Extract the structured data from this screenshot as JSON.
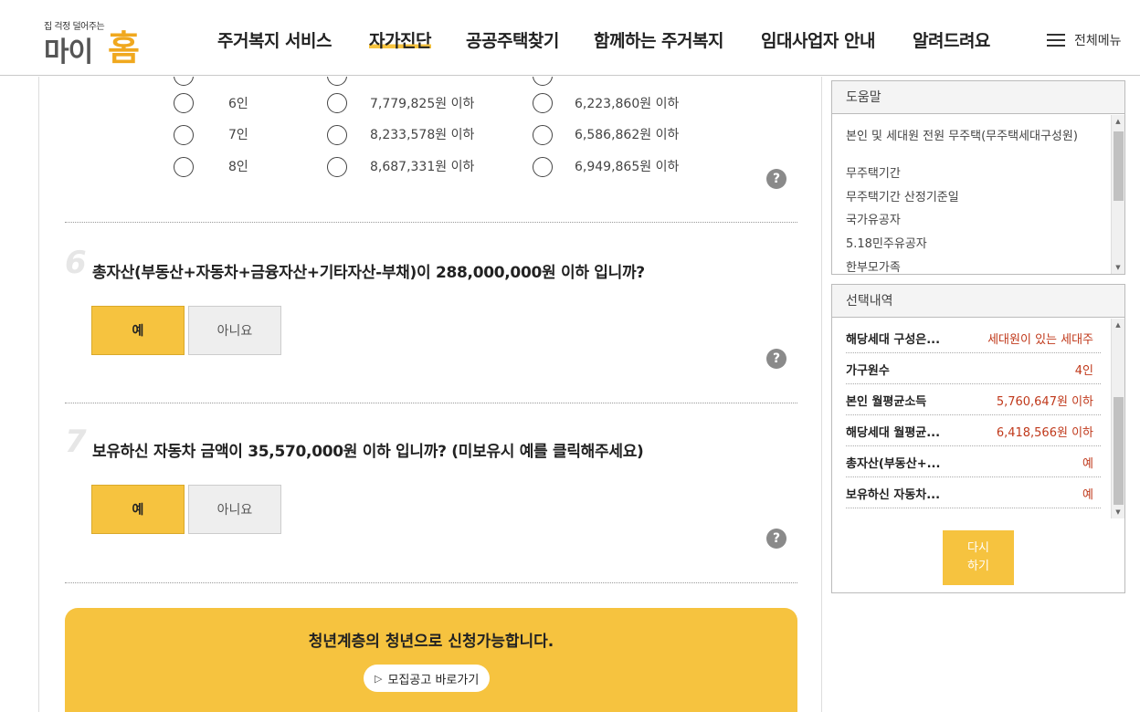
{
  "header": {
    "logo_tagline": "집 걱정 덜어주는",
    "logo_main": "마이",
    "logo_accent": "홈",
    "nav": [
      {
        "label": "주거복지 서비스"
      },
      {
        "label": "자가진단"
      },
      {
        "label": "공공주택찾기"
      },
      {
        "label": "함께하는 주거복지"
      },
      {
        "label": "임대사업자 안내"
      },
      {
        "label": "알려드려요"
      }
    ],
    "menu_all_label": "전체메뉴"
  },
  "income_table": {
    "rows": [
      {
        "household": "6인",
        "a": "7,779,825원 이하",
        "b": "6,223,860원 이하"
      },
      {
        "household": "7인",
        "a": "8,233,578원 이하",
        "b": "6,586,862원 이하"
      },
      {
        "household": "8인",
        "a": "8,687,331원 이하",
        "b": "6,949,865원 이하"
      }
    ]
  },
  "questions": [
    {
      "number": "6",
      "text": "총자산(부동산+자동차+금융자산+기타자산-부채)이 288,000,000원 이하 입니까?",
      "yes": "예",
      "no": "아니요"
    },
    {
      "number": "7",
      "text": "보유하신 자동차 금액이 35,570,000원 이하 입니까? (미보유시 예를 클릭해주세요)",
      "yes": "예",
      "no": "아니요"
    }
  ],
  "help_icon": "?",
  "result": {
    "message": "청년계층의 청년으로 신청가능합니다.",
    "link_label": "모집공고 바로가기"
  },
  "help_panel": {
    "title": "도움말",
    "items": [
      "본인 및 세대원 전원 무주택(무주택세대구성원)",
      "무주택기간",
      "무주택기간 산정기준일",
      "국가유공자",
      "5.18민주유공자",
      "한부모가족"
    ]
  },
  "selection_panel": {
    "title": "선택내역",
    "rows": [
      {
        "key": "해당세대 구성은...",
        "value": "세대원이 있는 세대주"
      },
      {
        "key": "가구원수",
        "value": "4인"
      },
      {
        "key": "본인 월평균소득",
        "value": "5,760,647원 이하"
      },
      {
        "key": "해당세대 월평균...",
        "value": "6,418,566원 이하"
      },
      {
        "key": "총자산(부동산+...",
        "value": "예"
      },
      {
        "key": "보유하신 자동차...",
        "value": "예"
      }
    ],
    "redo_line1": "다시",
    "redo_line2": "하기"
  },
  "colors": {
    "accent": "#f6c33f",
    "value_red": "#c0391b",
    "logo_orange": "#f0a81e"
  }
}
